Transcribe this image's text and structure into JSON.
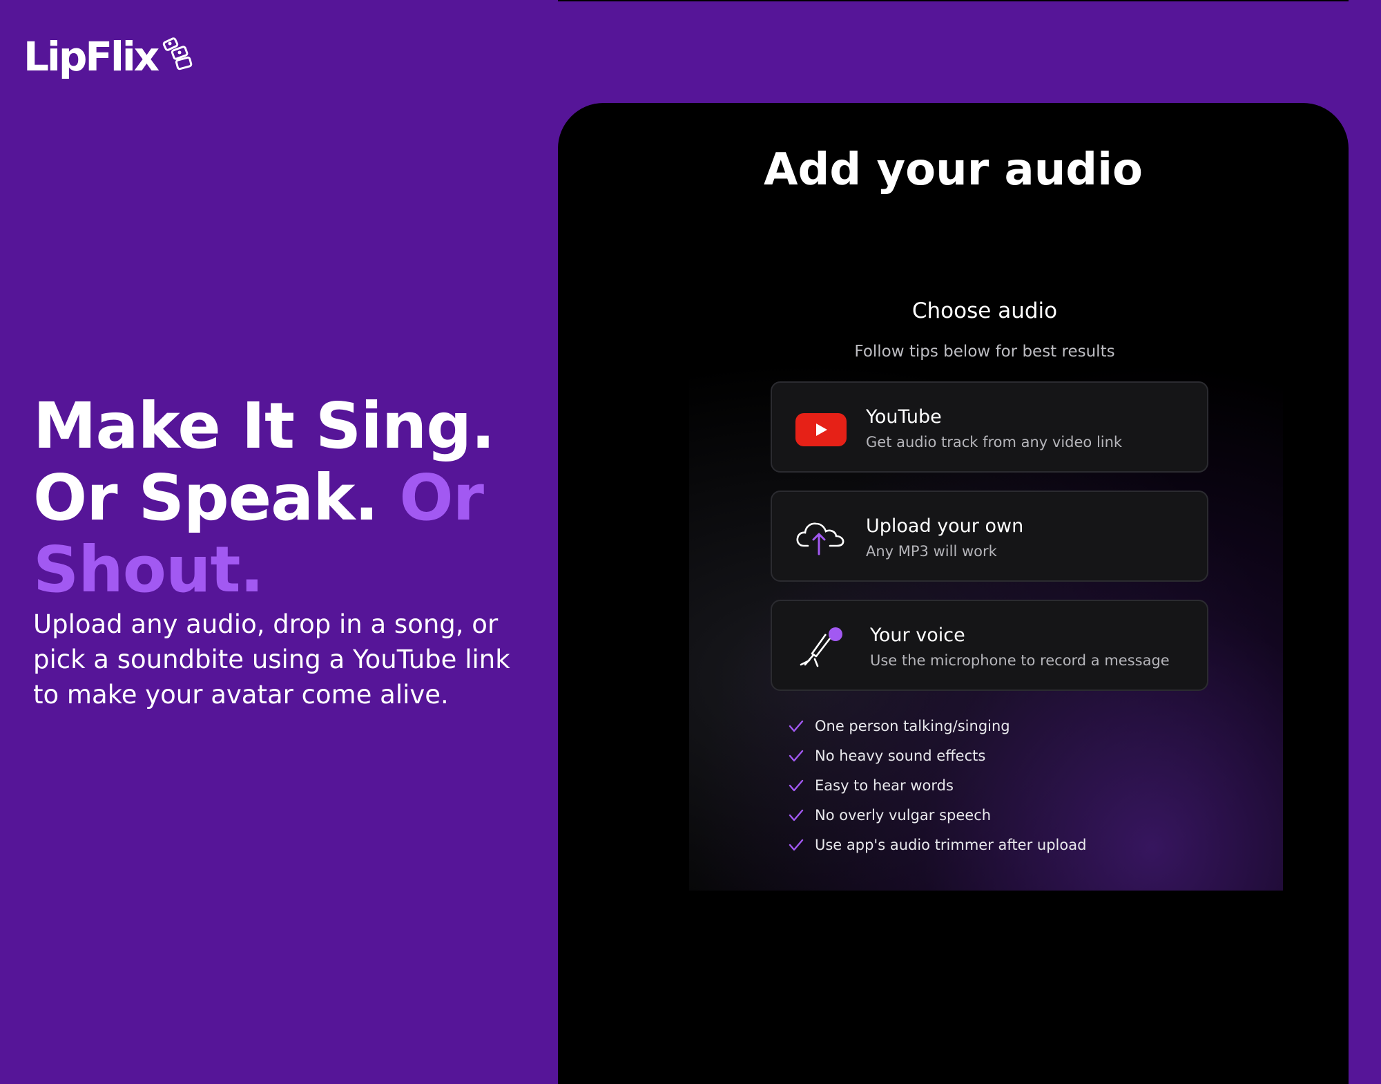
{
  "brand": {
    "name": "LipFlix"
  },
  "hero": {
    "headline_part1": "Make It Sing. Or Speak.",
    "headline_part2": "Or Shout.",
    "subtext": "Upload any audio, drop in a song, or pick a soundbite using a YouTube link to make your avatar come alive."
  },
  "panel": {
    "title": "Add your audio",
    "choose_label": "Choose audio",
    "tips_label": "Follow tips below for best results",
    "options": [
      {
        "title": "YouTube",
        "description": "Get audio track from any video link",
        "icon": "youtube-icon"
      },
      {
        "title": "Upload your own",
        "description": "Any MP3 will work",
        "icon": "cloud-upload-icon"
      },
      {
        "title": "Your voice",
        "description": "Use the microphone to record a message",
        "icon": "microphone-icon"
      }
    ],
    "tips": [
      "One person talking/singing",
      "No heavy sound effects",
      "Easy to hear words",
      "No overly vulgar speech",
      "Use app's audio trimmer after upload"
    ]
  },
  "colors": {
    "background": "#561598",
    "accent": "#a259f2",
    "panel": "#000000",
    "youtube_red": "#e62117"
  }
}
